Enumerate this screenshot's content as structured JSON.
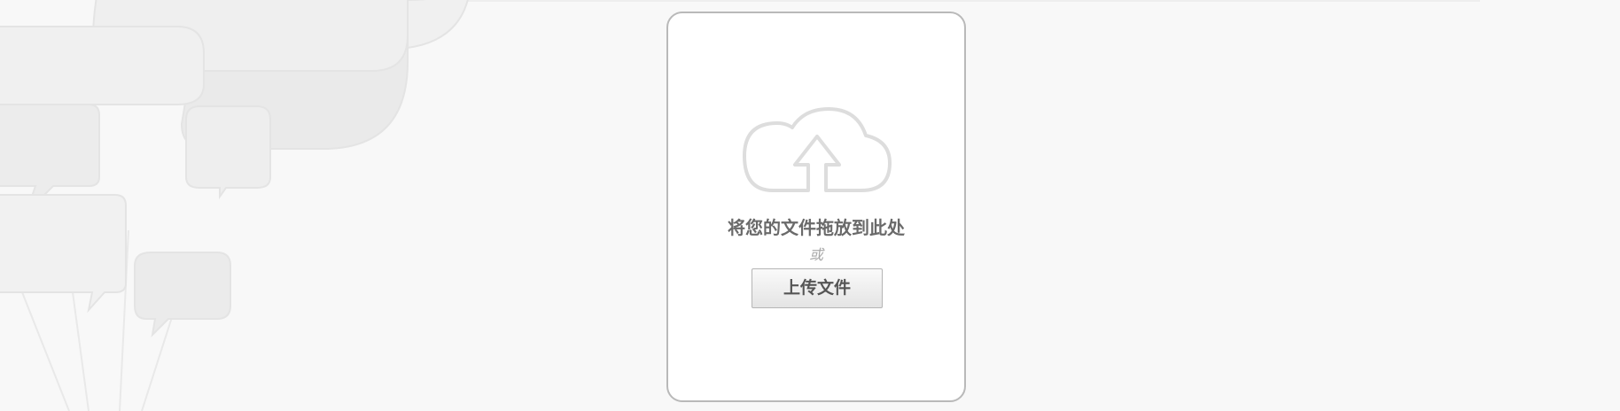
{
  "dropzone": {
    "drop_text": "将您的文件拖放到此处",
    "or_text": "或",
    "upload_button_label": "上传文件",
    "icon": "cloud-upload-icon"
  },
  "background": {
    "decoration": "speech-bubble-balloons-illustration"
  },
  "colors": {
    "page_background": "#f8f8f8",
    "card_background": "#ffffff",
    "card_border": "#b9b9b9",
    "text": "#6a6a6a",
    "muted_text": "#a8a8a8",
    "icon_stroke": "#dddddd"
  }
}
